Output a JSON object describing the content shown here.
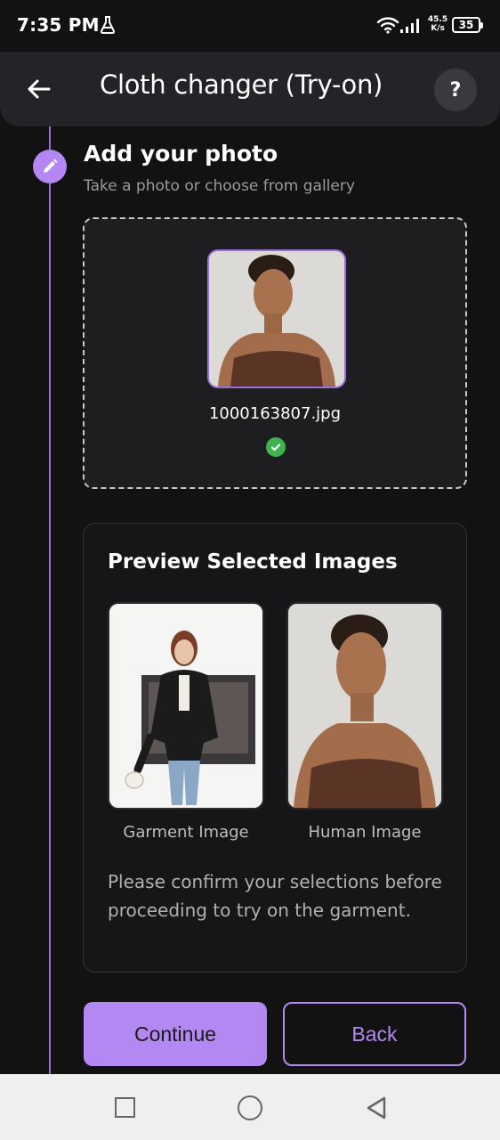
{
  "status_bar": {
    "time": "7:35 PM",
    "net_speed_value": "45.5",
    "net_speed_unit": "K/s",
    "battery": "35",
    "icons": [
      "flask-icon",
      "wifi-icon",
      "signal-icon",
      "battery-icon"
    ]
  },
  "app_bar": {
    "title": "Cloth changer (Try-on)",
    "help_label": "?",
    "back_icon": "arrow-left-icon"
  },
  "step": {
    "icon": "pencil-icon",
    "title": "Add your photo",
    "subtitle": "Take a photo or choose from gallery"
  },
  "upload": {
    "filename": "1000163807.jpg",
    "status_icon": "check-circle-icon"
  },
  "preview": {
    "title": "Preview Selected Images",
    "garment_caption": "Garment Image",
    "human_caption": "Human Image",
    "confirm_text": "Please confirm your selections before proceeding to try on the garment."
  },
  "actions": {
    "continue_label": "Continue",
    "back_label": "Back"
  },
  "colors": {
    "accent": "#b388f2",
    "background": "#121212",
    "success": "#3fb34f"
  },
  "nav_bar": {
    "icons": [
      "recent-apps-icon",
      "home-icon",
      "back-nav-icon"
    ]
  }
}
